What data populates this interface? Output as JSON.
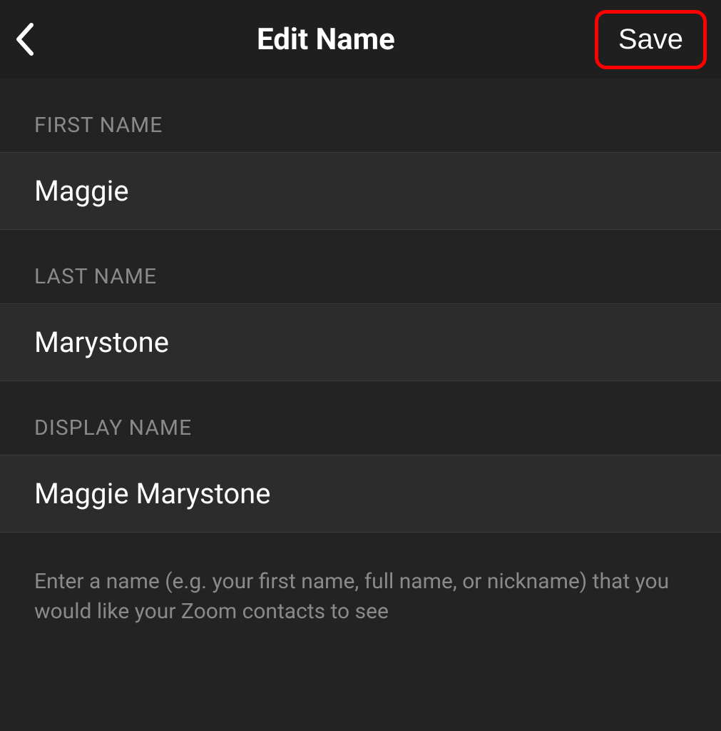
{
  "header": {
    "title": "Edit Name",
    "save_label": "Save"
  },
  "form": {
    "first_name": {
      "label": "FIRST NAME",
      "value": "Maggie"
    },
    "last_name": {
      "label": "LAST NAME",
      "value": "Marystone"
    },
    "display_name": {
      "label": "DISPLAY NAME",
      "value": "Maggie Marystone",
      "helper": "Enter a name (e.g. your first name, full name, or nickname) that you would like your Zoom contacts to see"
    }
  }
}
